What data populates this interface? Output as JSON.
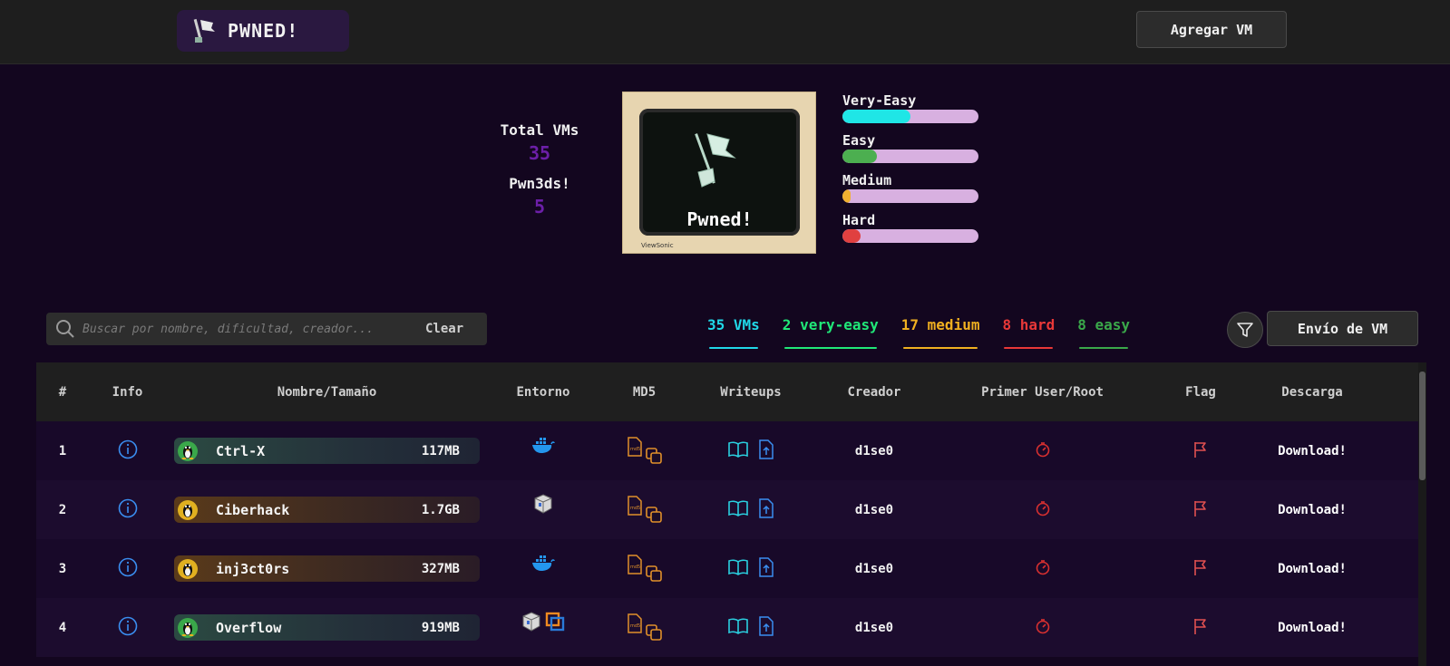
{
  "app": {
    "logo_text": "PWNED!"
  },
  "header": {
    "add_vm_label": "Agregar VM"
  },
  "stats": {
    "total_label": "Total VMs",
    "total_value": "35",
    "pwned_label": "Pwn3ds!",
    "pwned_value": "5"
  },
  "monitor": {
    "screen_text": "Pwned!",
    "brand": "ViewSonic"
  },
  "difficulty": [
    {
      "label": "Very-Easy",
      "fraction": 0.5,
      "color": "#1fe6e6"
    },
    {
      "label": "Easy",
      "fraction": 0.25,
      "color": "#4caf50"
    },
    {
      "label": "Medium",
      "fraction": 0.06,
      "color": "#f0b030"
    },
    {
      "label": "Hard",
      "fraction": 0.13,
      "color": "#e04040"
    }
  ],
  "search": {
    "placeholder": "Buscar por nombre, dificultad, creador...",
    "clear_label": "Clear"
  },
  "filters": [
    {
      "label": "35 VMs",
      "color": "#20d8e8"
    },
    {
      "label": "2 very-easy",
      "color": "#20e878"
    },
    {
      "label": "17 medium",
      "color": "#f0b020"
    },
    {
      "label": "8 hard",
      "color": "#e83838"
    },
    {
      "label": "8 easy",
      "color": "#3aa84a"
    }
  ],
  "envio_label": "Envío de VM",
  "table": {
    "headers": [
      "#",
      "Info",
      "Nombre/Tamaño",
      "Entorno",
      "MD5",
      "Writeups",
      "Creador",
      "Primer User/Root",
      "Flag",
      "Descarga"
    ],
    "rows": [
      {
        "num": "1",
        "name": "Ctrl-X",
        "size": "117MB",
        "difficulty": "easy",
        "env": "docker-icon",
        "creator": "d1se0",
        "download": "Download!"
      },
      {
        "num": "2",
        "name": "Ciberhack",
        "size": "1.7GB",
        "difficulty": "medium",
        "env": "virtualbox-icon",
        "creator": "d1se0",
        "download": "Download!"
      },
      {
        "num": "3",
        "name": "inj3ct0rs",
        "size": "327MB",
        "difficulty": "medium",
        "env": "docker-icon",
        "creator": "d1se0",
        "download": "Download!"
      },
      {
        "num": "4",
        "name": "Overflow",
        "size": "919MB",
        "difficulty": "easy",
        "env": "virtualbox-vmware-icon",
        "creator": "d1se0",
        "download": "Download!"
      }
    ]
  }
}
